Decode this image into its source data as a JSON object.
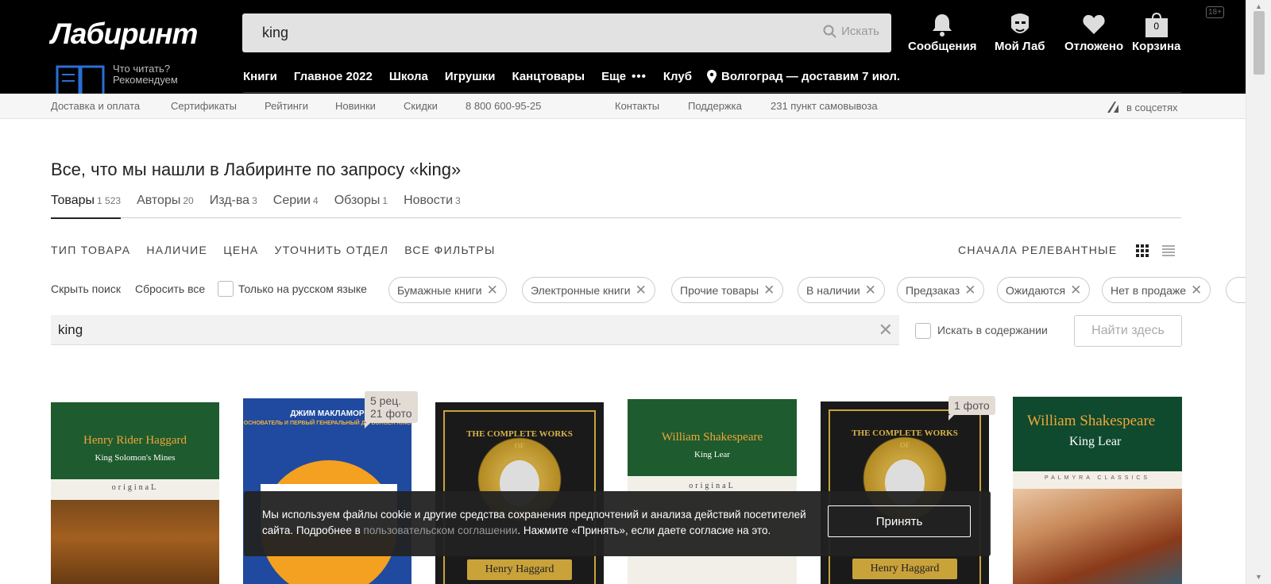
{
  "header": {
    "logo": "Лабиринт",
    "recommend_line1": "Что читать?",
    "recommend_line2": "Рекомендуем",
    "search_value": "king",
    "search_button": "Искать",
    "age_badge": "18+",
    "tools": {
      "notifications": "Сообщения",
      "my_lab": "Мой Лаб",
      "deferred": "Отложено",
      "cart": "Корзина",
      "cart_count": "0"
    },
    "nav": [
      "Книги",
      "Главное 2022",
      "Школа",
      "Игрушки",
      "Канцтовары",
      "Еще"
    ],
    "nav_more_dots": "•••",
    "nav_club": "Клуб",
    "location": "Волгоград — доставим 7 июл."
  },
  "subnav": {
    "left": [
      "Доставка и оплата",
      "Сертификаты",
      "Рейтинги",
      "Новинки",
      "Скидки",
      "8 800 600-95-25"
    ],
    "middle": [
      "Контакты",
      "Поддержка",
      "231 пункт самовывоза"
    ],
    "social": "в соцсетях"
  },
  "page": {
    "title": "Все, что мы нашли в Лабиринте по запросу «king»",
    "tabs": [
      {
        "label": "Товары",
        "count": "1 523"
      },
      {
        "label": "Авторы",
        "count": "20"
      },
      {
        "label": "Изд-ва",
        "count": "3"
      },
      {
        "label": "Серии",
        "count": "4"
      },
      {
        "label": "Обзоры",
        "count": "1"
      },
      {
        "label": "Новости",
        "count": "3"
      }
    ],
    "filters": [
      "ТИП ТОВАРА",
      "НАЛИЧИЕ",
      "ЦЕНА",
      "УТОЧНИТЬ ОТДЕЛ",
      "ВСЕ ФИЛЬТРЫ"
    ],
    "sort": "СНАЧАЛА РЕЛЕВАНТНЫЕ",
    "hide_search": "Скрыть поиск",
    "reset_all": "Сбросить все",
    "russian_only": "Только на русском языке",
    "chips": [
      "Бумажные книги",
      "Электронные книги",
      "Прочие товары",
      "В наличии",
      "Предзаказ",
      "Ожидаются",
      "Нет в продаже"
    ],
    "inner_search_value": "king",
    "search_in_content": "Искать в содержании",
    "find_here": "Найти здесь"
  },
  "products": [
    {
      "author": "Henry Rider Haggard",
      "title": "King Solomon's Mines",
      "series": "originaL"
    },
    {
      "top": "ДЖИМ МАКЛАМОР",
      "subtitle": "ОСНОВАТЕЛЬ И ПЕРВЫЙ ГЕНЕРАЛЬНЫЙ Д... BURGER KING",
      "badge_line1": "5 рец.",
      "badge_line2": "21 фото"
    },
    {
      "top": "THE COMPLETE WORKS",
      "of": "OF",
      "author": "Henry Haggard"
    },
    {
      "author": "William Shakespeare",
      "title": "King Lear",
      "series": "originaL"
    },
    {
      "top": "THE COMPLETE WORKS",
      "of": "OF",
      "author": "Henry Haggard",
      "badge": "1 фото"
    },
    {
      "author": "William Shakespeare",
      "title": "King Lear",
      "series": "PALMYRA CLASSICS"
    }
  ],
  "cookie": {
    "text_before": "Мы используем файлы cookie и другие средства сохранения предпочтений и анализа действий посетителей сайта. Подробнее в ",
    "link": "пользовательском соглашении",
    "text_after": ". Нажмите «Принять», если даете согласие на это.",
    "accept": "Принять"
  },
  "colors": {
    "header_bg": "#000000",
    "cover_green": "#1e5b2e",
    "cover_orange_text": "#f0a53a",
    "burger_blue": "#1f4aa0",
    "gold": "#c9a23a"
  }
}
